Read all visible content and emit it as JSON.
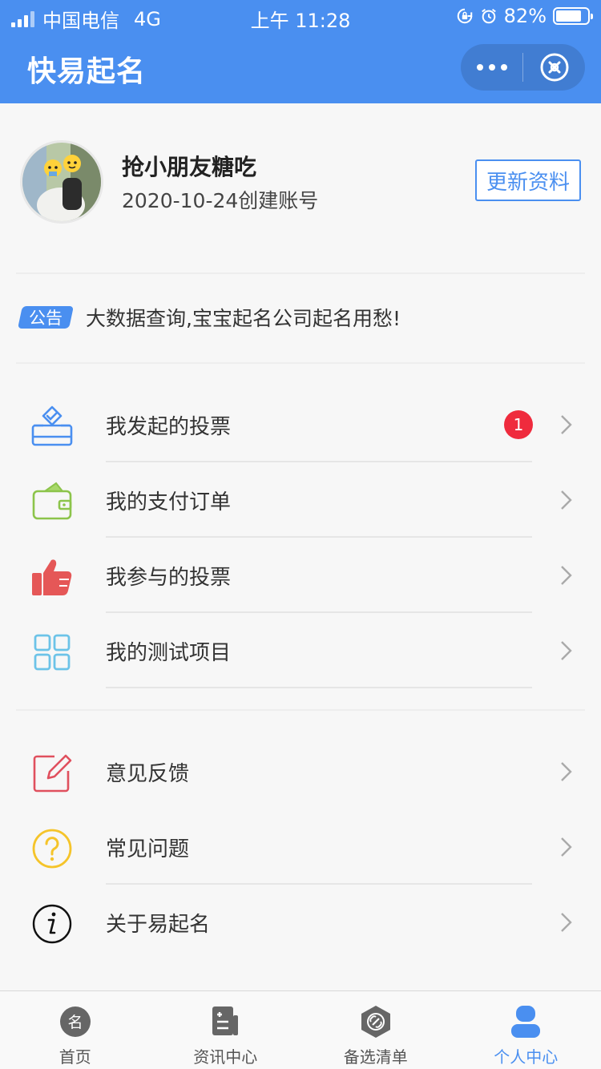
{
  "status_bar": {
    "carrier": "中国电信",
    "network": "4G",
    "time": "上午 11:28",
    "battery": "82%",
    "battery_level": 0.82
  },
  "navbar": {
    "title": "快易起名",
    "more_icon": "ellipsis-icon",
    "close_icon": "close-circle-icon",
    "color": "#4a8ff0"
  },
  "profile": {
    "username": "抢小朋友糖吃",
    "created": "2020-10-24创建账号",
    "update_label": "更新资料"
  },
  "notice": {
    "tag": "公告",
    "text": "大数据查询,宝宝起名公司起名用愁!"
  },
  "menu_group1": [
    {
      "label": "我发起的投票",
      "icon": "vote-box-icon",
      "badge": "1"
    },
    {
      "label": "我的支付订单",
      "icon": "wallet-icon"
    },
    {
      "label": "我参与的投票",
      "icon": "thumbs-up-icon"
    },
    {
      "label": "我的测试项目",
      "icon": "grid-icon"
    }
  ],
  "menu_group2": [
    {
      "label": "意见反馈",
      "icon": "edit-icon"
    },
    {
      "label": "常见问题",
      "icon": "question-icon"
    },
    {
      "label": "关于易起名",
      "icon": "info-icon"
    }
  ],
  "tabbar": [
    {
      "label": "首页",
      "icon": "home-name-icon",
      "active": false
    },
    {
      "label": "资讯中心",
      "icon": "news-icon",
      "active": false
    },
    {
      "label": "备选清单",
      "icon": "link-hex-icon",
      "active": false
    },
    {
      "label": "个人中心",
      "icon": "user-icon",
      "active": true
    }
  ],
  "colors": {
    "accent": "#4a8ff0",
    "badge": "#ef2b3d"
  }
}
